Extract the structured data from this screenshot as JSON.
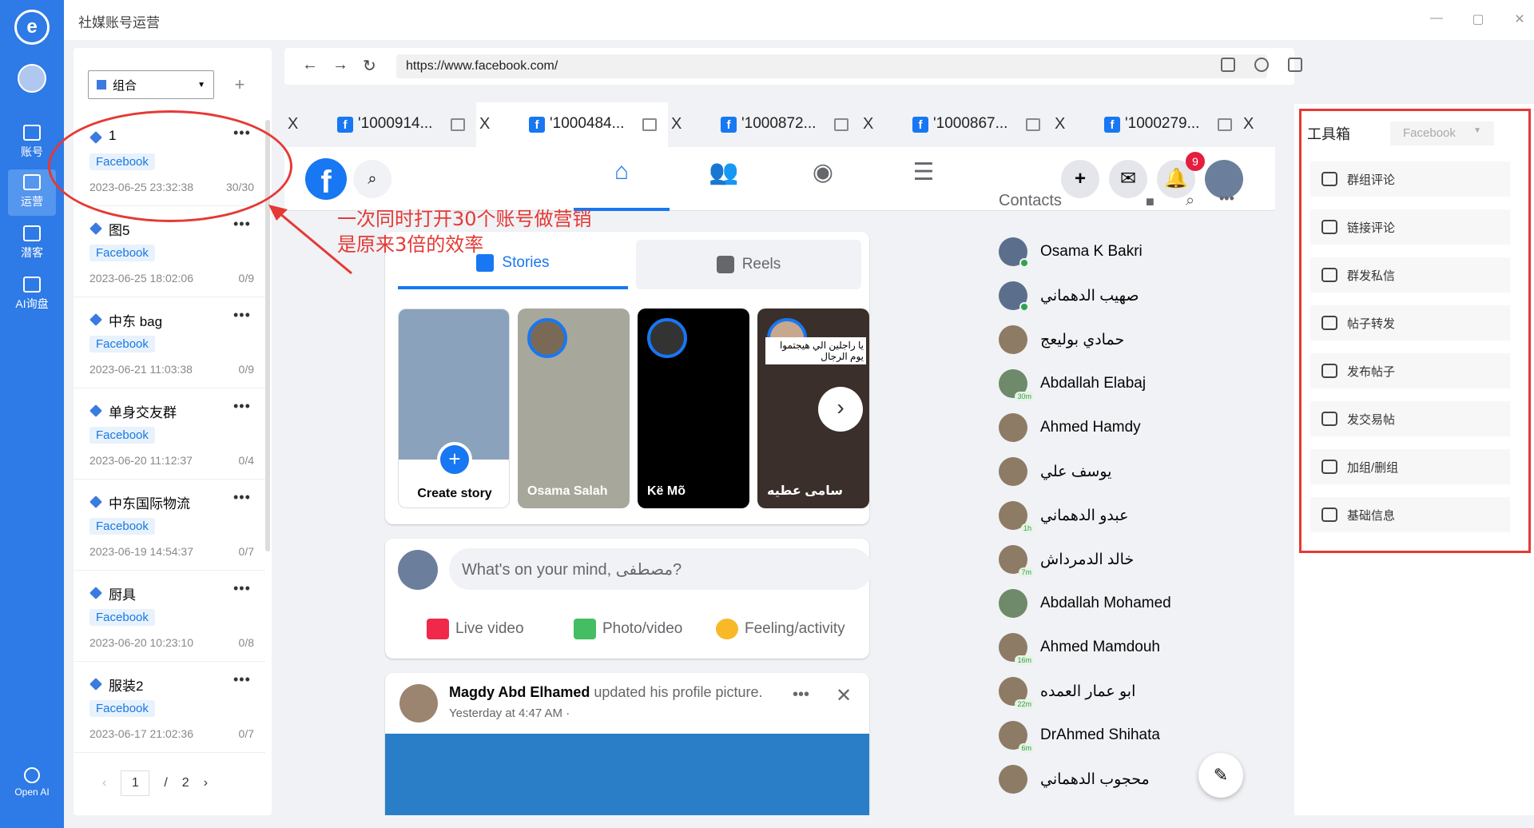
{
  "app": {
    "title": "社媒账号运营"
  },
  "leftnav": {
    "items": [
      {
        "label": "账号",
        "icon": "facebook-icon"
      },
      {
        "label": "运营",
        "icon": "calendar-icon"
      },
      {
        "label": "潜客",
        "icon": "users-icon"
      },
      {
        "label": "AI询盘",
        "icon": "ai-icon"
      }
    ],
    "bottom": {
      "label": "Open AI",
      "icon": "openai-icon"
    }
  },
  "accounts": {
    "group_label": "组合",
    "add": "+",
    "list": [
      {
        "name": "1",
        "platform": "Facebook",
        "date": "2023-06-25 23:32:38",
        "count": "30/30"
      },
      {
        "name": "图5",
        "platform": "Facebook",
        "date": "2023-06-25 18:02:06",
        "count": "0/9"
      },
      {
        "name": "中东 bag",
        "platform": "Facebook",
        "date": "2023-06-21 11:03:38",
        "count": "0/9"
      },
      {
        "name": "单身交友群",
        "platform": "Facebook",
        "date": "2023-06-20 11:12:37",
        "count": "0/4"
      },
      {
        "name": "中东国际物流",
        "platform": "Facebook",
        "date": "2023-06-19 14:54:37",
        "count": "0/7"
      },
      {
        "name": "厨具",
        "platform": "Facebook",
        "date": "2023-06-20 10:23:10",
        "count": "0/8"
      },
      {
        "name": "服装2",
        "platform": "Facebook",
        "date": "2023-06-17 21:02:36",
        "count": "0/7"
      }
    ],
    "pager": {
      "current": "1",
      "sep": "/",
      "total": "2"
    }
  },
  "browser": {
    "url": "https://www.facebook.com/",
    "tabs": [
      {
        "label": "'1000914..."
      },
      {
        "label": "'1000484..."
      },
      {
        "label": "'1000872..."
      },
      {
        "label": "'1000867..."
      },
      {
        "label": "'1000279..."
      }
    ],
    "close": "X"
  },
  "facebook": {
    "notifications": "9",
    "stories_tabs": [
      "Stories",
      "Reels"
    ],
    "stories": [
      {
        "name": "Create story"
      },
      {
        "name": "Osama Salah"
      },
      {
        "name": "Kë Mõ"
      },
      {
        "name": "سامى عطيه"
      }
    ],
    "story_overlay_text": "يا راجلين الي هيجتموا يوم الرجال",
    "composer": {
      "placeholder": "What's on your mind, مصطفى?",
      "actions": [
        "Live video",
        "Photo/video",
        "Feeling/activity"
      ]
    },
    "post": {
      "author": "Magdy Abd Elhamed",
      "action": "updated his profile picture.",
      "time": "Yesterday at 4:47 AM ·"
    },
    "contacts_title": "Contacts",
    "contacts": [
      {
        "name": "Osama K Bakri",
        "badge": ""
      },
      {
        "name": "صهيب الدهماني",
        "badge": ""
      },
      {
        "name": "حمادي بوليعج",
        "badge": ""
      },
      {
        "name": "Abdallah Elabaj",
        "badge": "30m"
      },
      {
        "name": "Ahmed Hamdy",
        "badge": ""
      },
      {
        "name": "يوسف علي",
        "badge": ""
      },
      {
        "name": "عبدو الدهماني",
        "badge": "1h"
      },
      {
        "name": "خالد الدمرداش",
        "badge": "7m"
      },
      {
        "name": "Abdallah Mohamed",
        "badge": ""
      },
      {
        "name": "Ahmed Mamdouh",
        "badge": "16m"
      },
      {
        "name": "ابو عمار العمده",
        "badge": "22m"
      },
      {
        "name": "DrAhmed Shihata",
        "badge": "6m"
      },
      {
        "name": "محجوب الدهماني",
        "badge": ""
      }
    ]
  },
  "toolbox": {
    "title": "工具箱",
    "platform": "Facebook",
    "items": [
      "群组评论",
      "链接评论",
      "群发私信",
      "帖子转发",
      "发布帖子",
      "发交易帖",
      "加组/删组",
      "基础信息"
    ]
  },
  "annotation": {
    "line1": "一次同时打开30个账号做营销",
    "line2": "是原来3倍的效率"
  }
}
